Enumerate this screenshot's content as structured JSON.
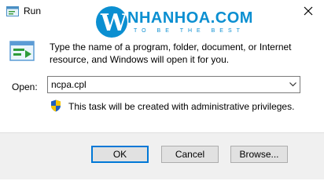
{
  "window": {
    "title": "Run",
    "close_glyph": "✕"
  },
  "watermark": {
    "letter": "W",
    "name": "NHANHOA.COM",
    "tagline": "TO BE THE BEST"
  },
  "dialog": {
    "description": "Type the name of a program, folder, document, or Internet resource, and Windows will open it for you.",
    "open_label": "Open:",
    "open_value": "ncpa.cpl",
    "admin_note": "This task will be created with administrative privileges."
  },
  "buttons": {
    "ok": "OK",
    "cancel": "Cancel",
    "browse": "Browse..."
  },
  "colors": {
    "accent": "#0078d7",
    "watermark": "#0b8fd1",
    "footer": "#f0f0f0"
  },
  "icons": [
    "run-app-icon",
    "close-icon",
    "run-dialog-icon",
    "dropdown-arrow-icon",
    "uac-shield-icon"
  ]
}
